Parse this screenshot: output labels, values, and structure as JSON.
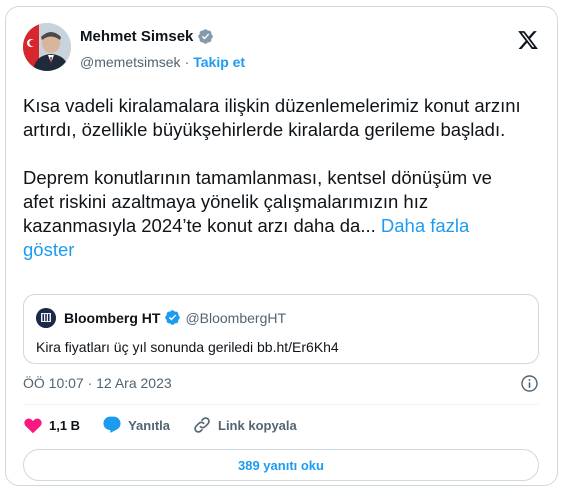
{
  "author": {
    "name": "Mehmet Simsek",
    "handle": "@memetsimsek",
    "separator": "·",
    "follow_label": "Takip et"
  },
  "tweet": {
    "text": "Kısa vadeli kiralamalara ilişkin düzenlemelerimiz konut arzını artırdı, özellikle büyükşehirlerde kiralarda gerileme başladı.\n\nDeprem konutlarının tamamlanması, kentsel dönüşüm ve afet riskini azaltmaya yönelik çalışmalarımızın hız kazanmasıyla 2024’te konut arzı daha da... ",
    "show_more": "Daha fazla göster"
  },
  "quote": {
    "name": "Bloomberg HT",
    "handle": "@BloombergHT",
    "text": "Kira fiyatları üç yıl sonunda geriledi bb.ht/Er6Kh4"
  },
  "meta": {
    "timestamp": "ÖÖ 10:07 · 12 Ara 2023"
  },
  "actions": {
    "likes": "1,1 B",
    "reply_label": "Yanıtla",
    "copy_link_label": "Link kopyala"
  },
  "read_replies_label": "389 yanıtı oku",
  "colors": {
    "accent": "#1d9bf0",
    "like": "#f91880",
    "text": "#0f1419",
    "muted": "#536471",
    "border": "#cfd9de"
  }
}
